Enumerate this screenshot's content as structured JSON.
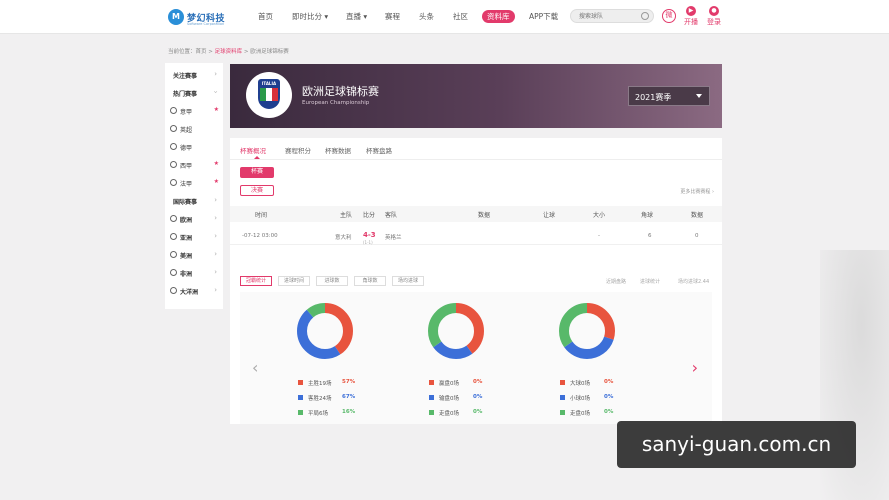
{
  "nav": {
    "logo_mark": "M",
    "logo_text": "梦幻科技",
    "logo_sub": "Software Corporation",
    "items": [
      "首页",
      "即时比分 ▾",
      "直播 ▾",
      "赛程",
      "头条",
      "社区",
      "资料库",
      "APP下载"
    ],
    "search_placeholder": "搜索球队",
    "weibo_label": "微",
    "live_label": "开播",
    "login_label": "登录"
  },
  "breadcrumb": {
    "prefix": "当前位置：",
    "home": "首页",
    "sep1": " > ",
    "section": "足球资料库",
    "sep2": " > ",
    "current": "欧洲足球锦标赛"
  },
  "sidebar": {
    "items": [
      {
        "label": "关注赛事",
        "type": "header"
      },
      {
        "label": "热门赛事",
        "type": "header"
      },
      {
        "label": "意甲",
        "type": "league",
        "star": "★"
      },
      {
        "label": "英超",
        "type": "league",
        "star": ""
      },
      {
        "label": "德甲",
        "type": "league",
        "star": ""
      },
      {
        "label": "西甲",
        "type": "league",
        "star": "★"
      },
      {
        "label": "法甲",
        "type": "league",
        "star": "★"
      },
      {
        "label": "国际赛事",
        "type": "header"
      },
      {
        "label": "欧洲",
        "type": "region"
      },
      {
        "label": "亚洲",
        "type": "region"
      },
      {
        "label": "美洲",
        "type": "region"
      },
      {
        "label": "非洲",
        "type": "region"
      },
      {
        "label": "大洋洲",
        "type": "region"
      }
    ],
    "arrow": "›"
  },
  "banner": {
    "badge_word": "ITALIA",
    "title": "欧洲足球锦标赛",
    "subtitle": "European Championship",
    "season": "2021赛季"
  },
  "tabs": [
    "杯赛概况",
    "赛程积分",
    "杯赛数据",
    "杯赛盘路"
  ],
  "stage_buttons": [
    "杯赛",
    "决赛"
  ],
  "more_link": "更多比赛赛程 ›",
  "table": {
    "headers": [
      "时间",
      "主队",
      "比分",
      "客队",
      "数据",
      "让球",
      "大小",
      "角球",
      "数据"
    ],
    "rows": [
      {
        "time": "-07-12 03:00",
        "home": "意大利",
        "score": "4-3",
        "half": "(1-1)",
        "away": "英格兰",
        "handicap": "-",
        "total": "-",
        "corners": "6",
        "data": "0"
      }
    ]
  },
  "stats_tabs": [
    "冠霸统计",
    "进球时间",
    "进球数",
    "角球数",
    "场均进球"
  ],
  "stats_right": [
    "近期盘路",
    "进球统计",
    "场均进球2.44"
  ],
  "arrows": {
    "left": "‹",
    "right": "›"
  },
  "donuts": [
    {
      "segments": [
        {
          "label": "主胜19场",
          "pct": "57%",
          "value": 57,
          "color": "#e8543e"
        },
        {
          "label": "客胜24场",
          "pct": "67%",
          "value": 67,
          "color": "#3c6fd8"
        },
        {
          "label": "平局6场",
          "pct": "16%",
          "value": 16,
          "color": "#58b96a"
        }
      ]
    },
    {
      "segments": [
        {
          "label": "赢盘0场",
          "pct": "0%",
          "value": 40,
          "color": "#e8543e"
        },
        {
          "label": "输盘0场",
          "pct": "0%",
          "value": 25,
          "color": "#3c6fd8"
        },
        {
          "label": "走盘0场",
          "pct": "0%",
          "value": 35,
          "color": "#58b96a"
        }
      ]
    },
    {
      "segments": [
        {
          "label": "大球0场",
          "pct": "0%",
          "value": 30,
          "color": "#e8543e"
        },
        {
          "label": "小球0场",
          "pct": "0%",
          "value": 35,
          "color": "#3c6fd8"
        },
        {
          "label": "走盘0场",
          "pct": "0%",
          "value": 35,
          "color": "#58b96a"
        }
      ]
    }
  ],
  "watermark": "sanyi-guan.com.cn"
}
